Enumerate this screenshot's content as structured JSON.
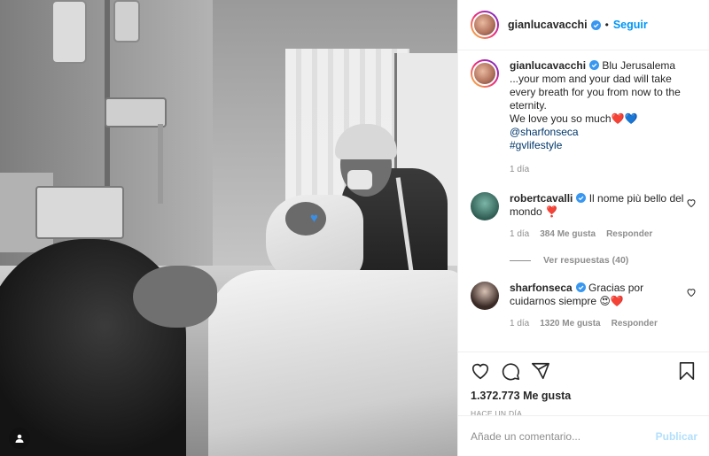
{
  "header": {
    "username": "gianlucavacchi",
    "separator": "•",
    "follow_label": "Seguir"
  },
  "caption": {
    "username": "gianlucavacchi",
    "text_line1": "Blu Jerusalema",
    "text_line2": "...your mom and your dad will take every breath for you from now to the eternity.",
    "text_line3": "We love you so much❤️💙",
    "mention": "@sharfonseca",
    "hashtag": "#gvlifestyle",
    "time": "1 día"
  },
  "comments": [
    {
      "username": "robertcavalli",
      "text": "Il nome più bello del mondo ❣️",
      "time": "1 día",
      "likes": "384 Me gusta",
      "reply_label": "Responder"
    },
    {
      "username": "sharfonseca",
      "text": "Gracias por cuidarnos siempre 😍❤️",
      "time": "1 día",
      "likes": "1320 Me gusta",
      "reply_label": "Responder"
    }
  ],
  "view_replies": "Ver respuestas (40)",
  "likes_count": "1.372.773 Me gusta",
  "posted_ago": "HACE UN DÍA",
  "comment_input": {
    "placeholder": "Añade un comentario...",
    "value": ""
  },
  "publish_label": "Publicar",
  "icons": {
    "like": "heart-icon",
    "comment": "comment-icon",
    "share": "share-icon",
    "save": "bookmark-icon",
    "verified": "verified-badge-icon",
    "tag": "user-tag-icon"
  },
  "colors": {
    "follow": "#0095f6",
    "publish_disabled": "#b2dffc",
    "mention": "#00376b",
    "muted": "#8e8e8e",
    "comment_heart": "#ed4956"
  }
}
